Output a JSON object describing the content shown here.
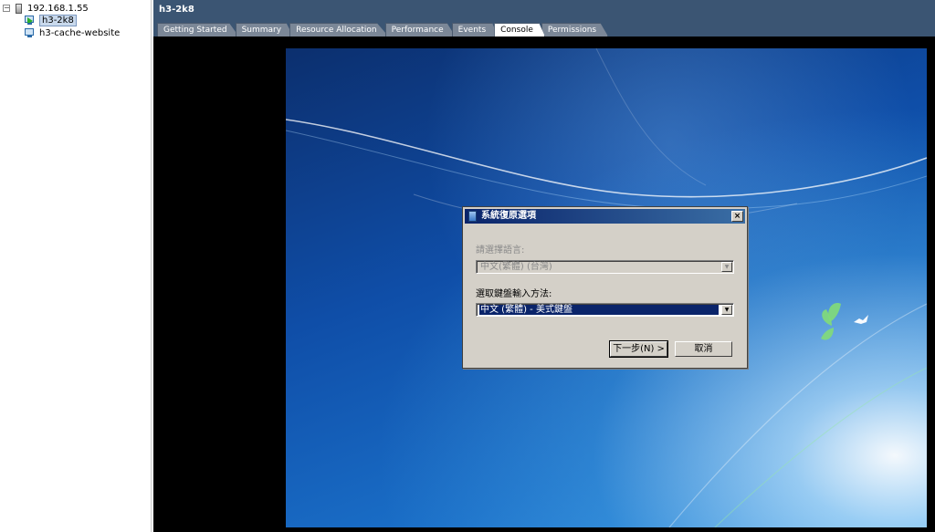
{
  "tree": {
    "host": {
      "label": "192.168.1.55",
      "expander": "−"
    },
    "vms": [
      {
        "label": "h3-2k8",
        "selected": true
      },
      {
        "label": "h3-cache-website",
        "selected": false
      }
    ]
  },
  "header": {
    "vm_title": "h3-2k8",
    "tabs": [
      {
        "label": "Getting Started"
      },
      {
        "label": "Summary"
      },
      {
        "label": "Resource Allocation"
      },
      {
        "label": "Performance"
      },
      {
        "label": "Events"
      },
      {
        "label": "Console",
        "active": true
      },
      {
        "label": "Permissions"
      }
    ]
  },
  "dialog": {
    "title": "系統復原選項",
    "close_glyph": "×",
    "language_label": "請選擇語言:",
    "language_value": "中文(繁體) (台灣)",
    "keyboard_label": "選取鍵盤輸入方法:",
    "keyboard_value": "中文 (繁體) - 美式鍵盤",
    "dropdown_glyph": "▼",
    "next_button": "下一步(N) >",
    "cancel_button": "取消"
  },
  "colors": {
    "header_bg": "#3b5573",
    "dialog_title": "#0a246a",
    "selection": "#0a246a"
  }
}
